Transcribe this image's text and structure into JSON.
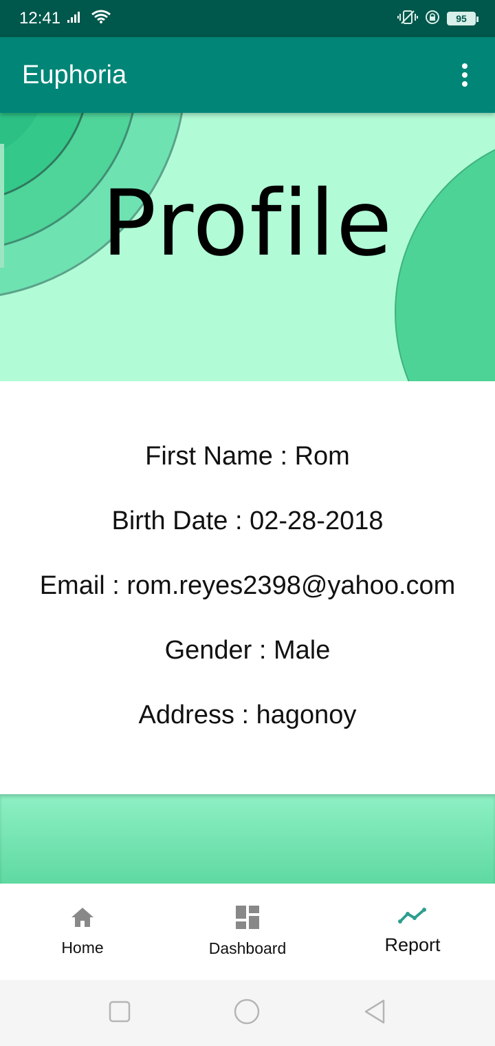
{
  "status_bar": {
    "time": "12:41",
    "battery_level": "95",
    "background": "#00574b"
  },
  "app_bar": {
    "title": "Euphoria",
    "background": "#008577",
    "menu_icon": "overflow-menu-icon"
  },
  "banner": {
    "title": "Profile",
    "background": "#b1fbd6"
  },
  "profile": {
    "first_name": "First Name : Rom",
    "birth_date": "Birth Date : 02-28-2018",
    "email": "Email : rom.reyes2398@yahoo.com",
    "gender": "Gender : Male",
    "address": "Address : hagonoy"
  },
  "bottom_nav": {
    "items": [
      {
        "label": "Home",
        "icon": "home-icon",
        "active": false
      },
      {
        "label": "Dashboard",
        "icon": "dashboard-icon",
        "active": false
      },
      {
        "label": "Report",
        "icon": "report-trend-icon",
        "active": true
      }
    ],
    "active_color": "#2e9e8f",
    "inactive_color": "#888888"
  },
  "system_nav": {
    "icons": [
      "recents-square-icon",
      "home-circle-icon",
      "back-triangle-icon"
    ]
  }
}
